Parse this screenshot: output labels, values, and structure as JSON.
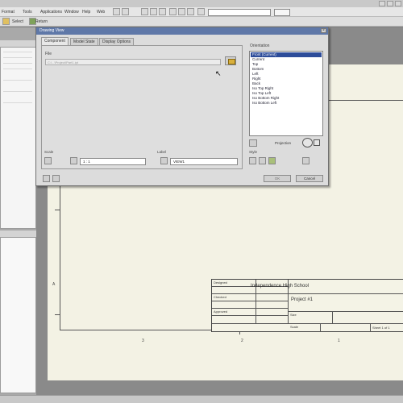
{
  "menubar": {
    "items": [
      "Format",
      "Tools",
      "Applications",
      "Window",
      "Help",
      "Web"
    ]
  },
  "toolbar": {
    "select_label": "Select",
    "return_label": "Return"
  },
  "dialog": {
    "title": "Drawing View",
    "close_glyph": "×",
    "tabs": [
      "Component",
      "Model State",
      "Display Options"
    ],
    "file_label": "File",
    "file_value": "C:\\...\\Project\\Part1.ipt",
    "orientation_label": "Orientation",
    "orientations": [
      "Front (Current)",
      "Current",
      "Top",
      "Bottom",
      "Left",
      "Right",
      "Back",
      "Iso Top Right",
      "Iso Top Left",
      "Iso Bottom Right",
      "Iso Bottom Left"
    ],
    "projection_label": "Projection",
    "scale_label": "Scale",
    "scale_value": "1 : 1",
    "view_label_label": "Label",
    "view_label_value": "VIEW1",
    "style_label": "Style",
    "ok_label": "OK",
    "cancel_label": "Cancel"
  },
  "titleblock": {
    "school": "Independence High School",
    "project": "Project #1",
    "drawn_label": "Designed",
    "checked_label": "Checked",
    "approved_label": "Approved",
    "size_label": "Size",
    "sheet_label": "Sheet 1 of 1",
    "scale_label": "Scale"
  },
  "zone_marks": {
    "left": "B",
    "left2": "A",
    "bottom": [
      "3",
      "2",
      "1"
    ]
  }
}
